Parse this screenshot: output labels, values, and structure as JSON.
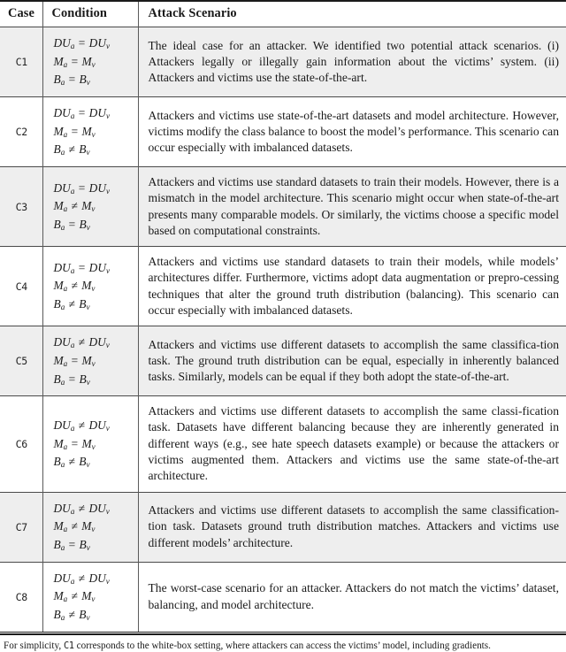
{
  "table": {
    "headers": {
      "case": "Case",
      "condition": "Condition",
      "scenario": "Attack Scenario"
    },
    "rows": [
      {
        "case": "C1",
        "shaded": true,
        "conditions": [
          {
            "lhs": "DU",
            "lsub": "a",
            "op": "=",
            "rhs": "DU",
            "rsub": "v"
          },
          {
            "lhs": "M",
            "lsub": "a",
            "op": "=",
            "rhs": "M",
            "rsub": "v"
          },
          {
            "lhs": "B",
            "lsub": "a",
            "op": "=",
            "rhs": "B",
            "rsub": "v"
          }
        ],
        "scenario": "The ideal case for an attacker. We identified two potential attack scenarios. (i) Attackers legally or illegally gain information about the victims’ system. (ii) Attackers and victims use the state-of-the-art."
      },
      {
        "case": "C2",
        "shaded": false,
        "conditions": [
          {
            "lhs": "DU",
            "lsub": "a",
            "op": "=",
            "rhs": "DU",
            "rsub": "v"
          },
          {
            "lhs": "M",
            "lsub": "a",
            "op": "=",
            "rhs": "M",
            "rsub": "v"
          },
          {
            "lhs": "B",
            "lsub": "a",
            "op": "≠",
            "rhs": "B",
            "rsub": "v"
          }
        ],
        "scenario": "Attackers and victims use state-of-the-art datasets and model architecture. However, victims modify the class balance to boost the model’s performance. This scenario can occur especially with imbalanced datasets."
      },
      {
        "case": "C3",
        "shaded": true,
        "conditions": [
          {
            "lhs": "DU",
            "lsub": "a",
            "op": "=",
            "rhs": "DU",
            "rsub": "v"
          },
          {
            "lhs": "M",
            "lsub": "a",
            "op": "≠",
            "rhs": "M",
            "rsub": "v"
          },
          {
            "lhs": "B",
            "lsub": "a",
            "op": "=",
            "rhs": "B",
            "rsub": "v"
          }
        ],
        "scenario": "Attackers and victims use standard datasets to train their models. However, there is a mismatch in the model architecture. This scenario might occur when state-of-the-art presents many comparable models. Or similarly, the victims choose a specific model based on computational constraints."
      },
      {
        "case": "C4",
        "shaded": false,
        "conditions": [
          {
            "lhs": "DU",
            "lsub": "a",
            "op": "=",
            "rhs": "DU",
            "rsub": "v"
          },
          {
            "lhs": "M",
            "lsub": "a",
            "op": "≠",
            "rhs": "M",
            "rsub": "v"
          },
          {
            "lhs": "B",
            "lsub": "a",
            "op": "≠",
            "rhs": "B",
            "rsub": "v"
          }
        ],
        "scenario": "Attackers and victims use standard datasets to train their models, while models’ architectures differ. Furthermore, victims adopt data augmentation or prepro-cessing techniques that alter the ground truth distribution (balancing). This scenario can occur especially with imbalanced datasets."
      },
      {
        "case": "C5",
        "shaded": true,
        "conditions": [
          {
            "lhs": "DU",
            "lsub": "a",
            "op": "≠",
            "rhs": "DU",
            "rsub": "v"
          },
          {
            "lhs": "M",
            "lsub": "a",
            "op": "=",
            "rhs": "M",
            "rsub": "v"
          },
          {
            "lhs": "B",
            "lsub": "a",
            "op": "=",
            "rhs": "B",
            "rsub": "v"
          }
        ],
        "scenario": "Attackers and victims use different datasets to accomplish the same classifica-tion task. The ground truth distribution can be equal, especially in inherently balanced tasks. Similarly, models can be equal if they both adopt the state-of-the-art."
      },
      {
        "case": "C6",
        "shaded": false,
        "conditions": [
          {
            "lhs": "DU",
            "lsub": "a",
            "op": "≠",
            "rhs": "DU",
            "rsub": "v"
          },
          {
            "lhs": "M",
            "lsub": "a",
            "op": "=",
            "rhs": "M",
            "rsub": "v"
          },
          {
            "lhs": "B",
            "lsub": "a",
            "op": "≠",
            "rhs": "B",
            "rsub": "v"
          }
        ],
        "scenario": "Attackers and victims use different datasets to accomplish the same classi-fication task. Datasets have different balancing because they are inherently generated in different ways (e.g., see hate speech datasets example) or because the attackers or victims augmented them. Attackers and victims use the same state-of-the-art architecture."
      },
      {
        "case": "C7",
        "shaded": true,
        "conditions": [
          {
            "lhs": "DU",
            "lsub": "a",
            "op": "≠",
            "rhs": "DU",
            "rsub": "v"
          },
          {
            "lhs": "M",
            "lsub": "a",
            "op": "≠",
            "rhs": "M",
            "rsub": "v"
          },
          {
            "lhs": "B",
            "lsub": "a",
            "op": "=",
            "rhs": "B",
            "rsub": "v"
          }
        ],
        "scenario": "Attackers and victims use different datasets to accomplish the same classification-tion task. Datasets ground truth distribution matches. Attackers and victims use different models’ architecture."
      },
      {
        "case": "C8",
        "shaded": false,
        "conditions": [
          {
            "lhs": "DU",
            "lsub": "a",
            "op": "≠",
            "rhs": "DU",
            "rsub": "v"
          },
          {
            "lhs": "M",
            "lsub": "a",
            "op": "≠",
            "rhs": "M",
            "rsub": "v"
          },
          {
            "lhs": "B",
            "lsub": "a",
            "op": "≠",
            "rhs": "B",
            "rsub": "v"
          }
        ],
        "scenario": "The worst-case scenario for an attacker. Attackers do not match the victims’ dataset, balancing, and model architecture."
      }
    ]
  },
  "footnote": {
    "prefix": "For simplicity, ",
    "code": "C1",
    "suffix": " corresponds to the white-box setting, where attackers can access the victims’ model, including gradients."
  }
}
